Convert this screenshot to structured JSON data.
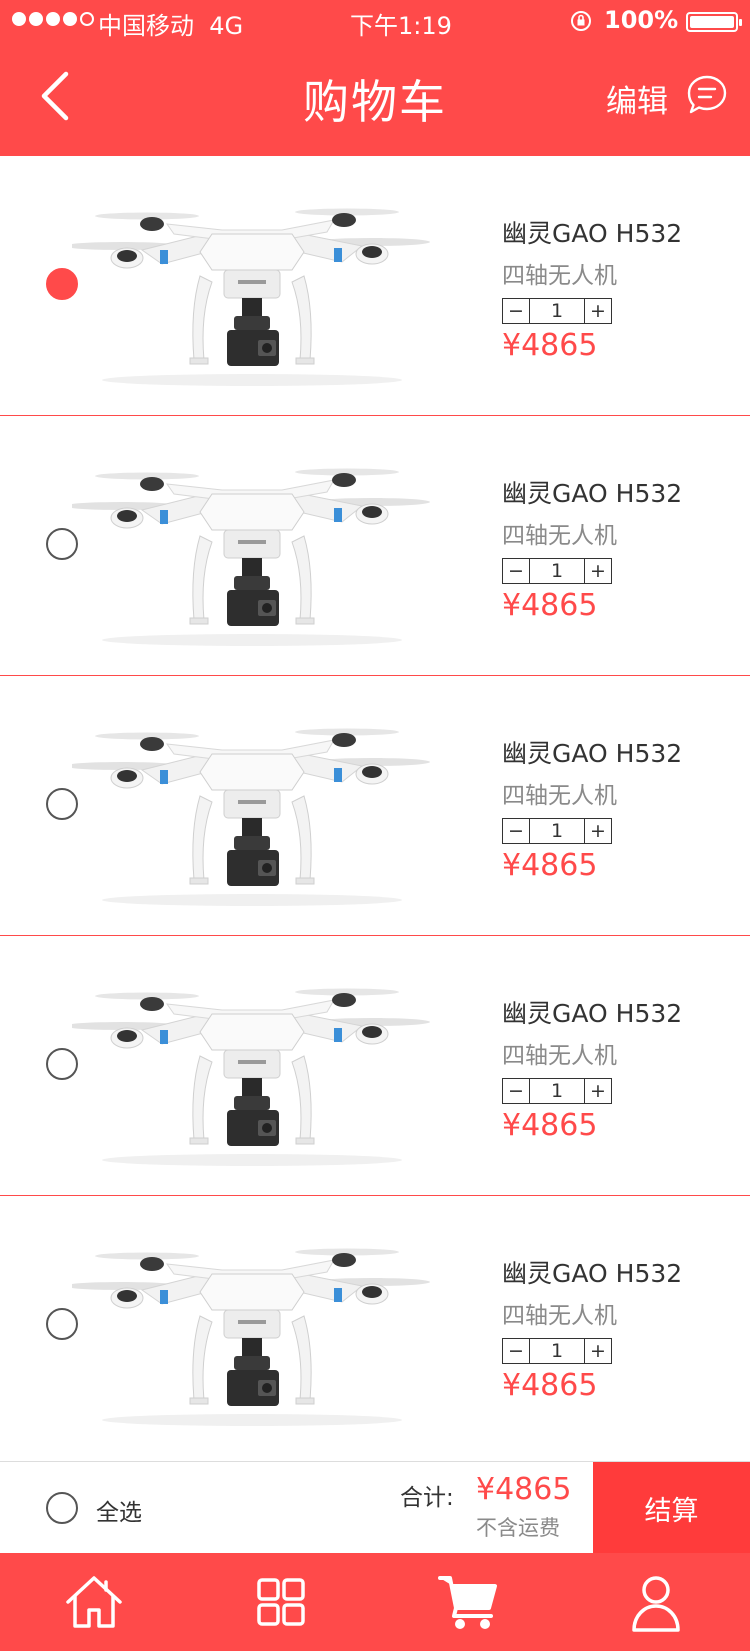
{
  "status_bar": {
    "carrier": "中国移动",
    "network": "4G",
    "time": "下午1:19",
    "battery": "100%",
    "battery_level": 1.0
  },
  "header": {
    "title": "购物车",
    "edit_label": "编辑",
    "back_icon": "chevron-left-icon",
    "message_icon": "chat-bubble-icon"
  },
  "cart": {
    "items": [
      {
        "name": "幽灵GAO   H532",
        "subtitle": "四轴无人机",
        "quantity": "1",
        "price": "¥4865",
        "selected": true
      },
      {
        "name": "幽灵GAO   H532",
        "subtitle": "四轴无人机",
        "quantity": "1",
        "price": "¥4865",
        "selected": false
      },
      {
        "name": "幽灵GAO   H532",
        "subtitle": "四轴无人机",
        "quantity": "1",
        "price": "¥4865",
        "selected": false
      },
      {
        "name": "幽灵GAO   H532",
        "subtitle": "四轴无人机",
        "quantity": "1",
        "price": "¥4865",
        "selected": false
      },
      {
        "name": "幽灵GAO   H532",
        "subtitle": "四轴无人机",
        "quantity": "1",
        "price": "¥4865",
        "selected": false
      }
    ],
    "stepper_minus": "−",
    "stepper_plus": "+"
  },
  "summary": {
    "select_all_label": "全选",
    "total_label": "合计:",
    "total_value": "¥4865",
    "shipping_note": "不含运费",
    "checkout_label": "结算"
  },
  "tabbar": {
    "items": [
      {
        "icon": "home-icon"
      },
      {
        "icon": "grid-icon"
      },
      {
        "icon": "cart-icon"
      },
      {
        "icon": "user-icon"
      }
    ]
  },
  "colors": {
    "accent": "#ff4a4a",
    "checkout_bg": "#ff3b3b",
    "secondary_text": "#8a8a8a"
  }
}
